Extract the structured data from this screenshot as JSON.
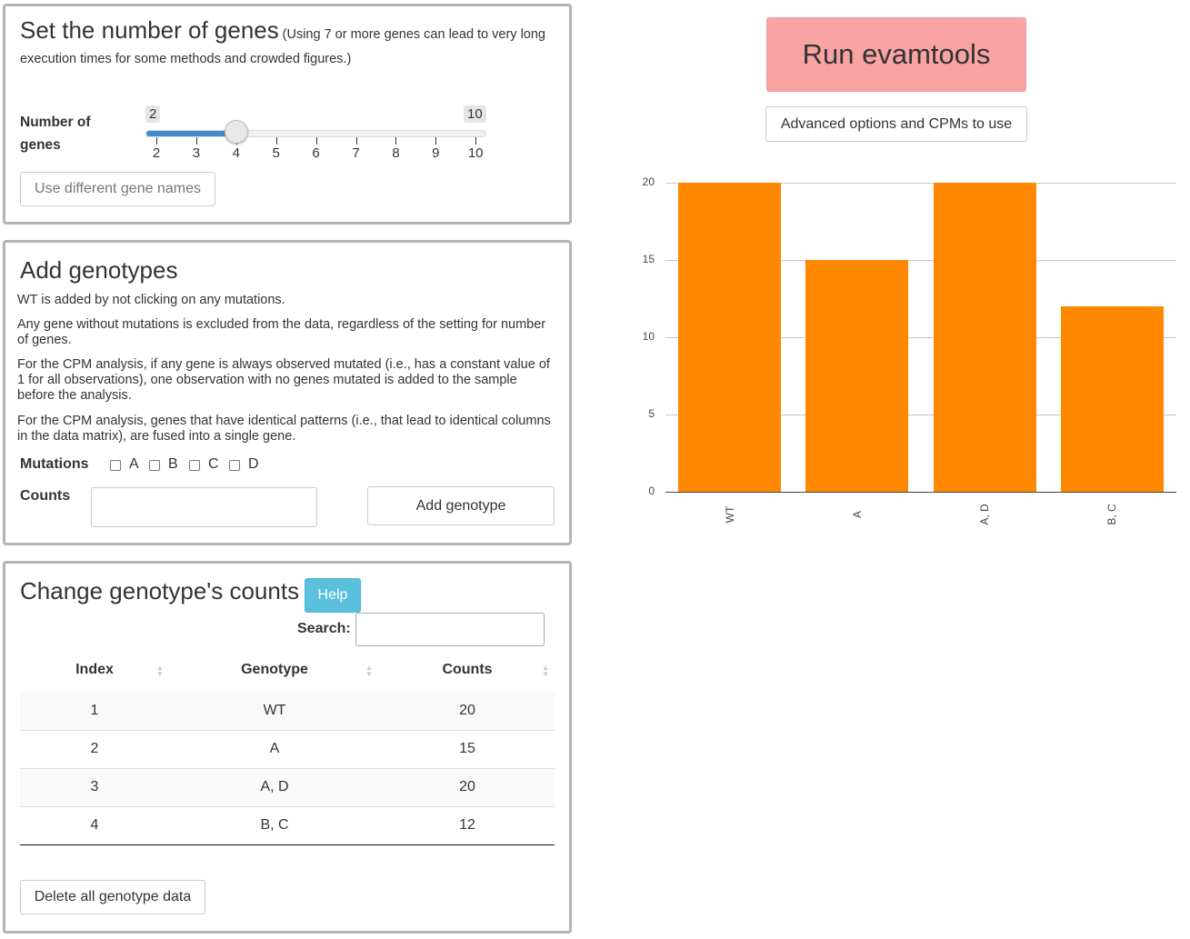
{
  "genes_panel": {
    "title": "Set the number of genes",
    "note": "(Using 7 or more genes can lead to very long execution times for some methods and crowded figures.)",
    "slider_label_1": "Number of",
    "slider_label_2": "genes",
    "slider_min": "2",
    "slider_max": "10",
    "slider_value": 4,
    "ticks": [
      "2",
      "3",
      "4",
      "5",
      "6",
      "7",
      "8",
      "9",
      "10"
    ],
    "gene_names_button": "Use different gene names"
  },
  "add_panel": {
    "title": "Add genotypes",
    "paragraphs": [
      "WT is added by not clicking on any mutations.",
      "Any gene without mutations is excluded from the data, regardless of the setting for number of genes.",
      "For the CPM analysis, if any gene is always observed mutated (i.e., has a constant value of 1 for all observations), one observation with no genes mutated is added to the sample before the analysis.",
      "For the CPM analysis, genes that have identical patterns (i.e., that lead to identical columns in the data matrix), are fused into a single gene."
    ],
    "mutations_label": "Mutations",
    "mutations": [
      "A",
      "B",
      "C",
      "D"
    ],
    "counts_label": "Counts",
    "counts_value": "",
    "add_button": "Add genotype"
  },
  "table_panel": {
    "title": "Change genotype's counts",
    "help_button": "Help",
    "search_label": "Search:",
    "search_value": "",
    "columns": [
      "Index",
      "Genotype",
      "Counts"
    ],
    "rows": [
      {
        "index": "1",
        "genotype": "WT",
        "counts": "20"
      },
      {
        "index": "2",
        "genotype": "A",
        "counts": "15"
      },
      {
        "index": "3",
        "genotype": "A, D",
        "counts": "20"
      },
      {
        "index": "4",
        "genotype": "B, C",
        "counts": "12"
      }
    ],
    "delete_button": "Delete all genotype data"
  },
  "right": {
    "run_button": "Run evamtools",
    "advanced_button": "Advanced options and CPMs to use"
  },
  "colors": {
    "run_button_bg": "#f9a3a3",
    "bar": "#ff8800",
    "slider_fill": "#428bca",
    "help_button": "#5bc0de"
  },
  "chart_data": {
    "type": "bar",
    "categories": [
      "WT",
      "A",
      "A, D",
      "B, C"
    ],
    "values": [
      20,
      15,
      20,
      12
    ],
    "yticks": [
      "0",
      "5",
      "10",
      "15",
      "20"
    ],
    "ylim": [
      0,
      20
    ],
    "title": "",
    "xlabel": "",
    "ylabel": ""
  }
}
